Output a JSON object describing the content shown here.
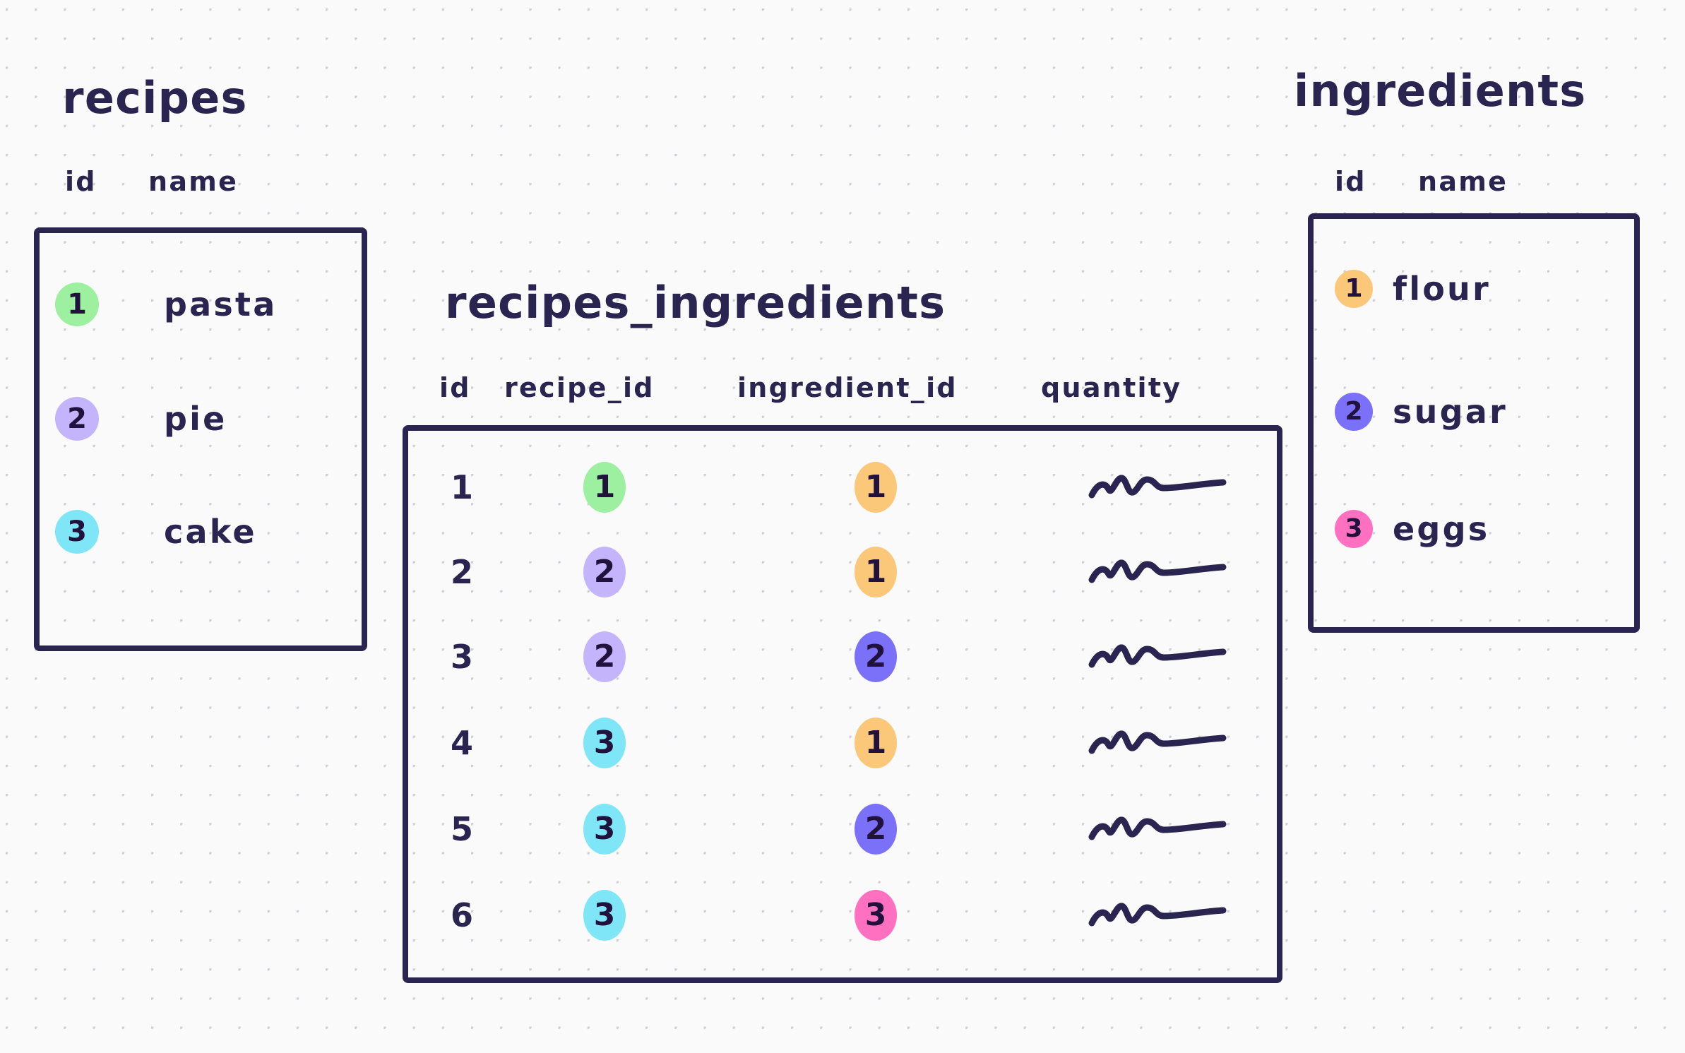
{
  "colors": {
    "ink": "#2a2450",
    "paper": "#fafafb",
    "grid_dot": "#cfcfd6",
    "green": "#9cf0a0",
    "lavender": "#c4b4fb",
    "cyan": "#7fe6f7",
    "orange": "#fbc87a",
    "indigo": "#7b70f8",
    "pink": "#ff70c0"
  },
  "recipes": {
    "title": "recipes",
    "columns": [
      "id",
      "name"
    ],
    "rows": [
      {
        "id": "1",
        "id_color": "#9cf0a0",
        "name": "pasta"
      },
      {
        "id": "2",
        "id_color": "#c4b4fb",
        "name": "pie"
      },
      {
        "id": "3",
        "id_color": "#7fe6f7",
        "name": "cake"
      }
    ]
  },
  "ingredients": {
    "title": "ingredients",
    "columns": [
      "id",
      "name"
    ],
    "rows": [
      {
        "id": "1",
        "id_color": "#fbc87a",
        "name": "flour"
      },
      {
        "id": "2",
        "id_color": "#7b70f8",
        "name": "sugar"
      },
      {
        "id": "3",
        "id_color": "#ff70c0",
        "name": "eggs"
      }
    ]
  },
  "recipes_ingredients": {
    "title": "recipes_ingredients",
    "columns": [
      "id",
      "recipe_id",
      "ingredient_id",
      "quantity"
    ],
    "rows": [
      {
        "id": "1",
        "recipe_id": "1",
        "recipe_color": "#9cf0a0",
        "ingredient_id": "1",
        "ingredient_color": "#fbc87a",
        "quantity": "squiggle-scribble"
      },
      {
        "id": "2",
        "recipe_id": "2",
        "recipe_color": "#c4b4fb",
        "ingredient_id": "1",
        "ingredient_color": "#fbc87a",
        "quantity": "squiggle-scribble"
      },
      {
        "id": "3",
        "recipe_id": "2",
        "recipe_color": "#c4b4fb",
        "ingredient_id": "2",
        "ingredient_color": "#7b70f8",
        "quantity": "squiggle-scribble"
      },
      {
        "id": "4",
        "recipe_id": "3",
        "recipe_color": "#7fe6f7",
        "ingredient_id": "1",
        "ingredient_color": "#fbc87a",
        "quantity": "squiggle-scribble"
      },
      {
        "id": "5",
        "recipe_id": "3",
        "recipe_color": "#7fe6f7",
        "ingredient_id": "2",
        "ingredient_color": "#7b70f8",
        "quantity": "squiggle-scribble"
      },
      {
        "id": "6",
        "recipe_id": "3",
        "recipe_color": "#7fe6f7",
        "ingredient_id": "3",
        "ingredient_color": "#ff70c0",
        "quantity": "squiggle-scribble"
      }
    ]
  }
}
